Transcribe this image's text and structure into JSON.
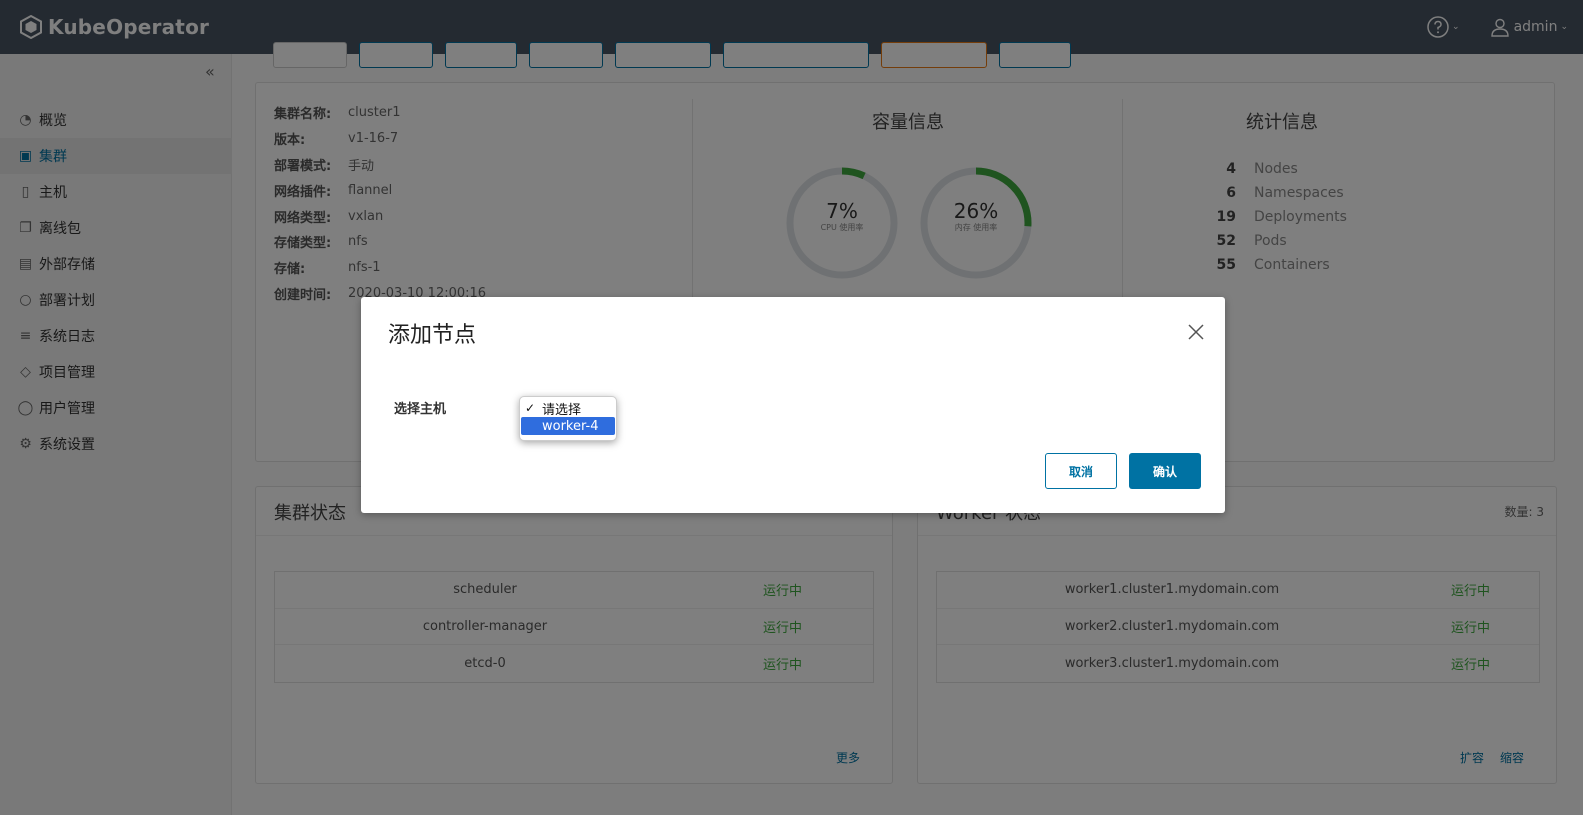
{
  "header": {
    "app_name": "KubeOperator",
    "user": "admin",
    "bg_color": "#485563"
  },
  "sidebar": {
    "items": [
      {
        "label": "概览",
        "icon": "dashboard-icon"
      },
      {
        "label": "集群",
        "icon": "cluster-icon",
        "active": true
      },
      {
        "label": "主机",
        "icon": "host-icon"
      },
      {
        "label": "离线包",
        "icon": "package-icon"
      },
      {
        "label": "外部存储",
        "icon": "storage-icon"
      },
      {
        "label": "部署计划",
        "icon": "plan-icon"
      },
      {
        "label": "系统日志",
        "icon": "log-icon"
      },
      {
        "label": "项目管理",
        "icon": "project-icon"
      },
      {
        "label": "用户管理",
        "icon": "user-icon"
      },
      {
        "label": "系统设置",
        "icon": "settings-icon"
      }
    ]
  },
  "cluster_info": {
    "rows": [
      {
        "label": "集群名称:",
        "value": "cluster1"
      },
      {
        "label": "版本:",
        "value": "v1-16-7"
      },
      {
        "label": "部署模式:",
        "value": "手动"
      },
      {
        "label": "网络插件:",
        "value": "flannel"
      },
      {
        "label": "网络类型:",
        "value": "vxlan"
      },
      {
        "label": "存储类型:",
        "value": "nfs"
      },
      {
        "label": "存储:",
        "value": "nfs-1"
      },
      {
        "label": "创建时间:",
        "value": "2020-03-10 12:00:16"
      }
    ]
  },
  "capacity": {
    "title": "容量信息",
    "cpu": {
      "value": 7,
      "label_pct": "7%",
      "label": "CPU 使用率"
    },
    "mem": {
      "value": 26,
      "label_pct": "26%",
      "label": "内存 使用率"
    }
  },
  "stats": {
    "title": "统计信息",
    "rows": [
      {
        "num": "4",
        "label": "Nodes"
      },
      {
        "num": "6",
        "label": "Namespaces"
      },
      {
        "num": "19",
        "label": "Deployments"
      },
      {
        "num": "52",
        "label": "Pods"
      },
      {
        "num": "55",
        "label": "Containers"
      }
    ]
  },
  "cluster_status": {
    "title": "集群状态",
    "rows": [
      {
        "name": "scheduler",
        "status": "运行中"
      },
      {
        "name": "controller-manager",
        "status": "运行中"
      },
      {
        "name": "etcd-0",
        "status": "运行中"
      }
    ],
    "more": "更多"
  },
  "worker_status": {
    "title": "Worker 状态",
    "count": "数量: 3",
    "rows": [
      {
        "name": "worker1.cluster1.mydomain.com",
        "status": "运行中"
      },
      {
        "name": "worker2.cluster1.mydomain.com",
        "status": "运行中"
      },
      {
        "name": "worker3.cluster1.mydomain.com",
        "status": "运行中"
      }
    ],
    "scale_up": "扩容",
    "scale_down": "缩容"
  },
  "modal": {
    "title": "添加节点",
    "field_label": "选择主机",
    "options": [
      "请选择",
      "worker-4"
    ],
    "selected": "请选择",
    "highlighted": "worker-4",
    "cancel": "取消",
    "confirm": "确认",
    "primary_color": "#0072a3"
  }
}
